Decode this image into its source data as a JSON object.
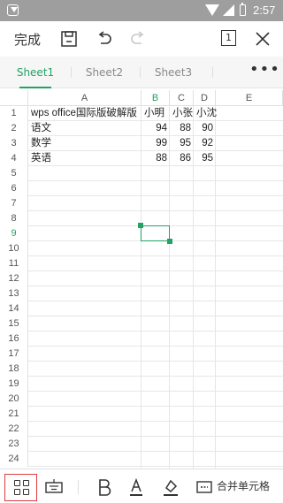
{
  "status_bar": {
    "time": "2:57"
  },
  "toolbar": {
    "done_label": "完成",
    "page_indicator": "1"
  },
  "tabs": [
    {
      "label": "Sheet1",
      "active": true
    },
    {
      "label": "Sheet2",
      "active": false
    },
    {
      "label": "Sheet3",
      "active": false
    }
  ],
  "more_label": "•••",
  "columns": [
    "A",
    "B",
    "C",
    "D",
    "E"
  ],
  "active_column": "B",
  "rows": [
    "1",
    "2",
    "3",
    "4",
    "5",
    "6",
    "7",
    "8",
    "9",
    "10",
    "11",
    "12",
    "13",
    "14",
    "15",
    "16",
    "17",
    "18",
    "19",
    "20",
    "21",
    "22",
    "23",
    "24"
  ],
  "active_row": "9",
  "cells": {
    "A1": "wps office国际版破解版",
    "B1": "小明",
    "C1": "小张",
    "D1": "小沈",
    "A2": "语文",
    "B2": "94",
    "C2": "88",
    "D2": "90",
    "A3": "数学",
    "B3": "99",
    "C3": "95",
    "D3": "92",
    "A4": "英语",
    "B4": "88",
    "C4": "86",
    "D4": "95"
  },
  "bottom_toolbar": {
    "merge_label": "合并单元格"
  },
  "colors": {
    "accent": "#21a366",
    "highlight_border": "#e0393e"
  }
}
